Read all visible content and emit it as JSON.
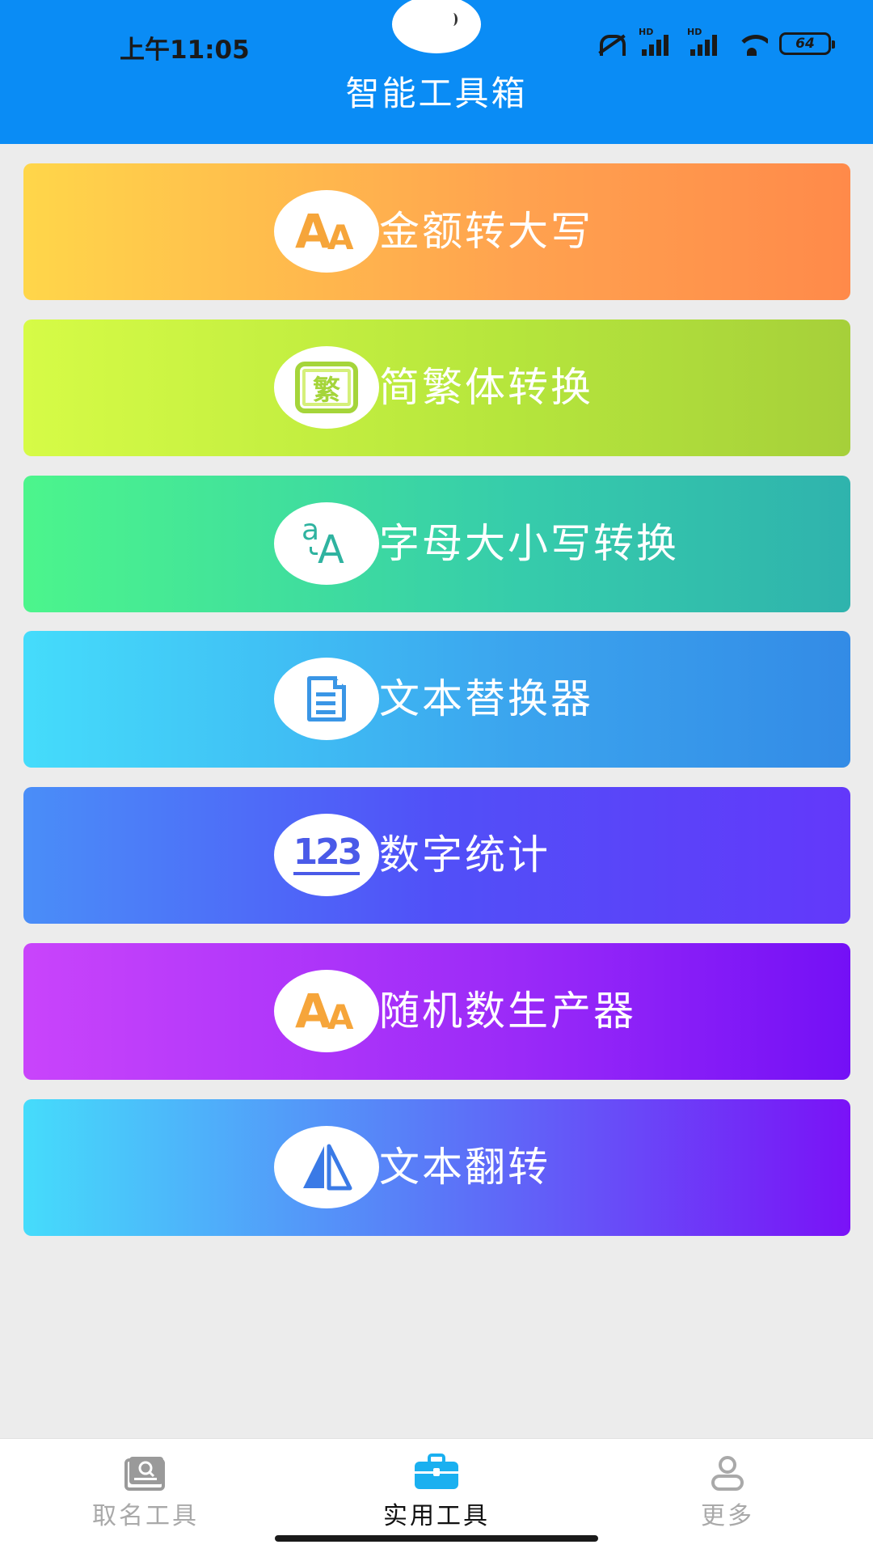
{
  "status_bar": {
    "time": "上午11:05",
    "battery": "64",
    "signal_label": "HD"
  },
  "header": {
    "title": "智能工具箱"
  },
  "tools": [
    {
      "label": "金额转大写",
      "icon": "aa-letters-icon",
      "icon_text_big": "A",
      "icon_text_small": "A",
      "color": "#f6a53a"
    },
    {
      "label": "简繁体转换",
      "icon": "traditional-char-icon",
      "icon_text": "繁",
      "color": "#a5d53a"
    },
    {
      "label": "字母大小写转换",
      "icon": "letter-case-icon",
      "icon_text_small": "a",
      "icon_text_big": "A",
      "color": "#2fb3a0"
    },
    {
      "label": "文本替换器",
      "icon": "document-icon",
      "color": "#3a96e6"
    },
    {
      "label": "数字统计",
      "icon": "number-123-icon",
      "icon_text": "123",
      "color": "#4a5ae8"
    },
    {
      "label": "随机数生产器",
      "icon": "aa-letters-icon",
      "icon_text_big": "A",
      "icon_text_small": "A",
      "color": "#f6a53a"
    },
    {
      "label": "文本翻转",
      "icon": "flip-triangle-icon",
      "color": "#4a7ee8"
    }
  ],
  "bottom_nav": {
    "items": [
      {
        "label": "取名工具",
        "icon": "name-card-icon",
        "active": false
      },
      {
        "label": "实用工具",
        "icon": "toolbox-icon",
        "active": true
      },
      {
        "label": "更多",
        "icon": "person-icon",
        "active": false
      }
    ]
  },
  "colors": {
    "header_bg": "#0a8cf5",
    "page_bg": "#ececec",
    "nav_active": "#1ab0f0",
    "nav_inactive": "#a9a9a9"
  }
}
